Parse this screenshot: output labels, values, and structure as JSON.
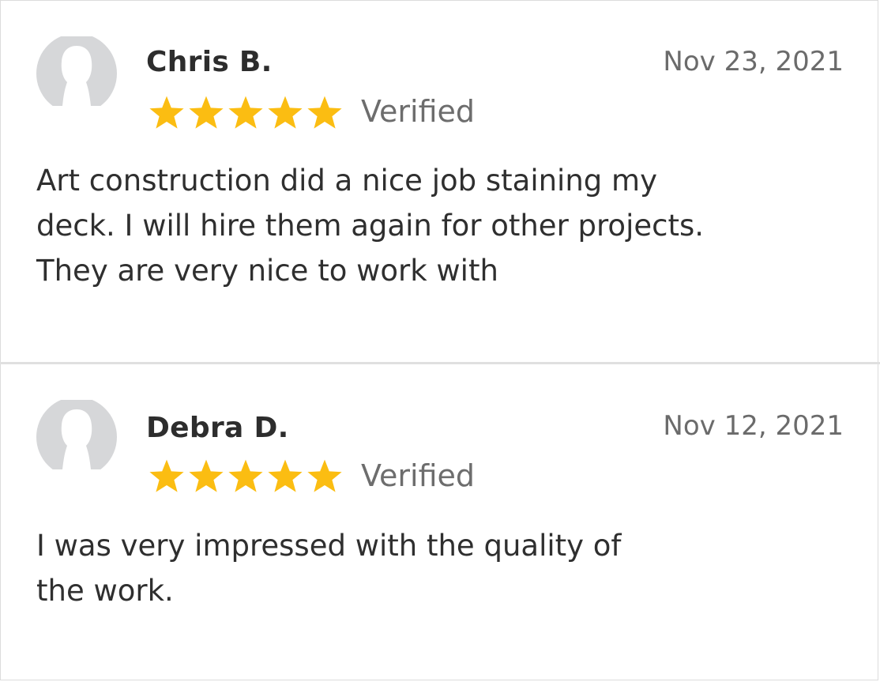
{
  "colors": {
    "star": "#fbbd12",
    "avatar": "#d6d7d9",
    "divider": "#e0e0e0"
  },
  "reviews": [
    {
      "name": "Chris B.",
      "date": "Nov 23, 2021",
      "rating": 5,
      "rating_max": 5,
      "verified_label": "Verified",
      "avatar_icon": "user-silhouette-icon",
      "text_lines": [
        "Art construction did a nice job staining my",
        "deck. I will hire them again for other projects.",
        "They are very nice to work with"
      ]
    },
    {
      "name": "Debra D.",
      "date": "Nov 12, 2021",
      "rating": 5,
      "rating_max": 5,
      "verified_label": "Verified",
      "avatar_icon": "user-silhouette-icon",
      "text_lines": [
        "I was very impressed with the quality of",
        "the work."
      ]
    }
  ]
}
